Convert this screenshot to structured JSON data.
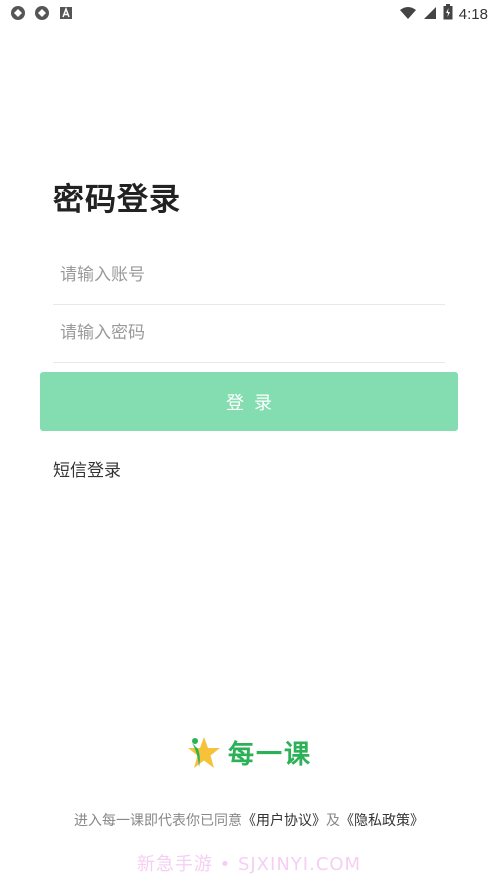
{
  "status_bar": {
    "time": "4:18"
  },
  "login": {
    "title": "密码登录",
    "account_placeholder": "请输入账号",
    "password_placeholder": "请输入密码",
    "submit_label": "登录",
    "sms_login_label": "短信登录"
  },
  "brand": {
    "name": "每一课"
  },
  "agreement": {
    "prefix": "进入每一课即代表你已同意",
    "user_agreement": "《用户协议》",
    "conjunction": "及",
    "privacy_policy": "《隐私政策》"
  },
  "watermark": "新急手游 • SJXINYI.COM",
  "colors": {
    "button": "#83ddb0",
    "brand_green": "#2cb158",
    "brand_star": "#f5c23a"
  }
}
